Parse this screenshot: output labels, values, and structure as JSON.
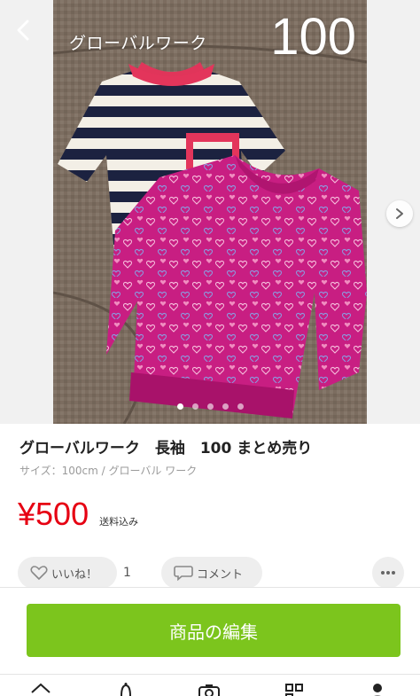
{
  "photo": {
    "brand_caption": "グローバルワーク",
    "size_caption": "100"
  },
  "carousel": {
    "dot_count": 5,
    "active_index": 0
  },
  "product": {
    "title": "グローバルワーク　長袖　100 まとめ売り",
    "subtitle": "サイズ：100cm / グローバル ワーク",
    "price": "¥500",
    "shipping": "送料込み"
  },
  "actions": {
    "like_label": "いいね！",
    "like_count": "1",
    "comment_label": "コメント"
  },
  "edit_button": {
    "label": "商品の編集"
  },
  "tabs": [
    "home-icon",
    "notice-icon",
    "camera-icon",
    "qr-icon",
    "mypage-icon"
  ],
  "colors": {
    "price": "#e60012",
    "edit_button": "#7cc51d",
    "pink_shirt": "#c81e82",
    "navy_stripe": "#1c2240"
  }
}
